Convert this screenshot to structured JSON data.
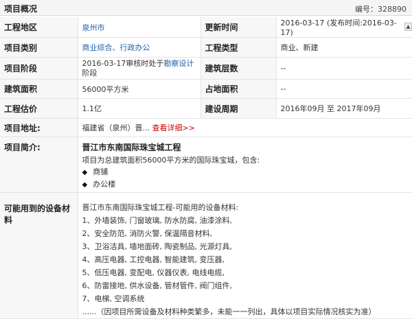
{
  "header": {
    "title": "项目概况",
    "code_label": "编号：",
    "code_value": "328890"
  },
  "rows": [
    {
      "l1": "工程地区",
      "v1": "泉州市",
      "l2": "更新时间",
      "v2": "2016-03-17 (发布时间:2016-03-17)"
    },
    {
      "l1": "项目类别",
      "v1": "商业综合、行政办公",
      "l2": "工程类型",
      "v2": "商业、新建"
    },
    {
      "l1": "项目阶段",
      "v1_pre": "2016-03-17审核时处于",
      "v1_link": "勘察设计",
      "v1_post": "阶段",
      "l2": "建筑层数",
      "v2": "--"
    },
    {
      "l1": "建筑面积",
      "v1": "56000平方米",
      "l2": "占地面积",
      "v2": "--"
    },
    {
      "l1": "工程估价",
      "v1": "1.1亿",
      "l2": "建设周期",
      "v2": "2016年09月 至 2017年09月"
    }
  ],
  "address": {
    "label": "项目地址:",
    "value": "福建省（泉州）晋...",
    "more": "查看详细>>"
  },
  "intro": {
    "label": "项目简介:",
    "title": "晋江市东南国际珠宝城工程",
    "line": "项目为总建筑面积56000平方米的国际珠宝城，包含:",
    "bullets": [
      "商铺",
      "办公楼"
    ]
  },
  "equipment": {
    "label": "可能用到的设备材料",
    "heading": "晋江市东南国际珠宝城工程-可能用的设备材料:",
    "items": [
      "1、外墙装饰, 门窗玻璃, 防水防腐, 油漆涂料,",
      "2、安全防范, 消防火警, 保温隔音材料,",
      "3、卫浴洁具, 墙地面砖, 陶瓷制品, 光源灯具,",
      "4、高压电器, 工控电器, 智能建筑, 变压器,",
      "5、低压电器, 变配电, 仪器仪表, 电线电缆,",
      "6、防雷接地, 供水设备, 管材管件, 阀门组件,",
      "7、电梯, 空调系统"
    ],
    "footer": "......（因项目所需设备及材料种类繁多，未能一一列出，具体以项目实际情况核实为准）"
  }
}
